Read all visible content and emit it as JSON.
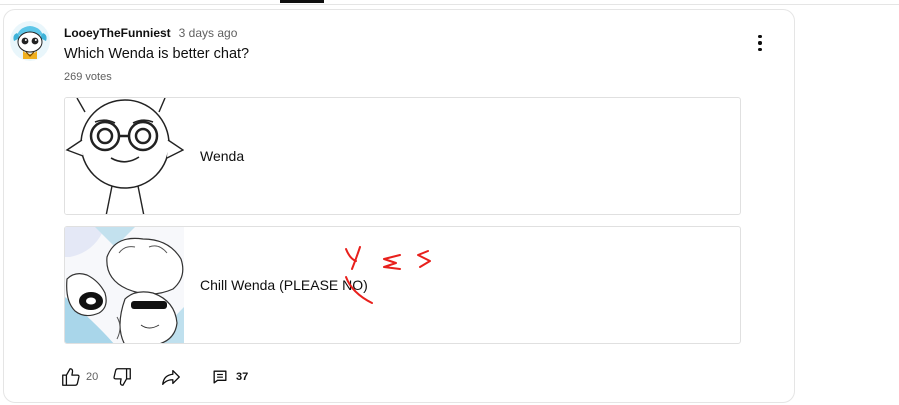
{
  "post": {
    "author": "LooeyTheFunniest",
    "time": "3 days ago",
    "question": "Which Wenda is better chat?",
    "votes": "269 votes"
  },
  "poll": {
    "options": [
      {
        "label": "Wenda"
      },
      {
        "label": "Chill Wenda (PLEASE NO)"
      }
    ]
  },
  "annotation": {
    "handwritten_text": "yes",
    "color": "#e8201c"
  },
  "actions": {
    "like_count": "20",
    "comment_count": "37"
  },
  "icons": {
    "menu": "more-vert-icon",
    "like": "thumbs-up-icon",
    "dislike": "thumbs-down-icon",
    "share": "share-icon",
    "comment": "comment-icon"
  }
}
